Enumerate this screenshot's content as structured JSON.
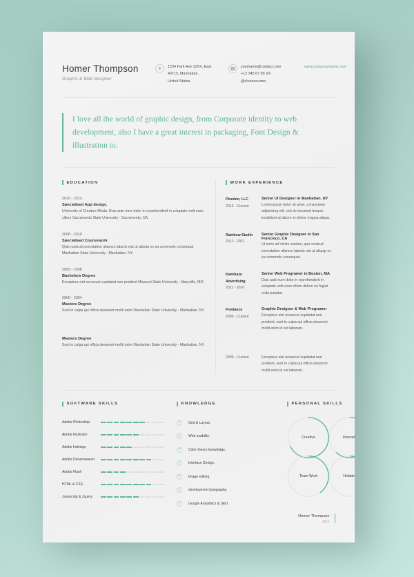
{
  "theme": {
    "accent": "#5fb79b",
    "page_bg": "#f2f2f2",
    "canvas_bg": "#a8ccc2"
  },
  "header": {
    "name": "Homer Thompson",
    "role": "Graphic & Web designer",
    "address_icon": "location-pin-icon",
    "address": [
      "1234 Park Ave 12XX, East",
      "40715, Manhattan.",
      "United States."
    ],
    "phone_icon": "phone-icon",
    "contact": [
      "yourname@contact.com",
      "+12 345 67 89 XX",
      "@cleanresume"
    ],
    "website": "www.companyname.com"
  },
  "quote": "I love all the world of graphic design, from Corporate identity to web development, also I have a great interest in packaging, Font Design & illustration to.",
  "education": {
    "title": "Education",
    "entries": [
      {
        "date": "2010 - 2013",
        "title": "Specialised App design.",
        "desc": "University of Creative Minds: Duis aute irure dolor in reprehenderit in voluptate velit esse cillum Sacramento State University - Sacramento, CA."
      },
      {
        "date": "2008 - 2010",
        "title": "Specialised Coursework",
        "desc": "Quis nostrud exercitation ullamco laboris nisi ut aliquip ex ea commodo consequat Manhattan State University - Manhattan. NY."
      },
      {
        "date": "2005 - 2008",
        "title": "Bachelors Degree",
        "desc": "Excepteur sint occaecat cupidatat non proident Missouri State University - Maryville, MO."
      },
      {
        "date": "2000 - 2004",
        "title": "Masters Degree",
        "desc": "Sunt in culpa qui officia deserunt mollit anim Manhattan State University - Manhattan. NY."
      },
      {
        "date": "",
        "title": "Masters Degree",
        "desc": "Sunt in culpa qui officia deserunt mollit anim Manhattan State University - Manhattan. NY."
      }
    ]
  },
  "work": {
    "title": "Work Experience",
    "entries": [
      {
        "company": "Pixeden, LLC",
        "period": "2013 - Current",
        "title": "Senior UI Designer in Manhattan, NY",
        "desc": "Lorem ipsum dolor sit amet, consectetur adipisicing elit, sed do eiusmod tempor incididunt ut labore et dolore magna aliqua."
      },
      {
        "company": "Rainbow Studio",
        "period": "2012 - 2011",
        "title": "Senior Graphic Designer in San Francisco, CA",
        "desc": "Ut enim ad minim veniam, quis nostrud exercitation ullamco laboris nisi ut aliquip ex ea commodo consequat."
      },
      {
        "company": "Kamikaze Advertising",
        "period": "2011 - 2010",
        "title": "Senior Web Programer in Boston, MA",
        "desc": "Duis aute irure dolor in reprehenderit in voluptate velit esse cillum dolore eu fugiat nulla pariatur."
      },
      {
        "company": "Freelance",
        "period": "2009 - Current",
        "title": "Graphic Designer & Web Programer",
        "desc": "Excepteur sint occaecat cupidatat non proident, sunt in culpa qui officia deserunt mollit anim id est laborum."
      },
      {
        "company": "",
        "period": "2009 - Current",
        "title": "",
        "desc": "Excepteur sint occaecat cupidatat non proident, sunt in culpa qui officia deserunt mollit anim id est laborum."
      }
    ]
  },
  "software_skills": {
    "title": "Software Skills",
    "total_segments": 10,
    "items": [
      {
        "label": "Adobe Photoshop",
        "filled": 7
      },
      {
        "label": "Adobe Illustrator",
        "filled": 6
      },
      {
        "label": "Adobe Indesign",
        "filled": 5
      },
      {
        "label": "Adobe Dreamweaver",
        "filled": 8
      },
      {
        "label": "Adobe Flash",
        "filled": 4
      },
      {
        "label": "HTML & CSS",
        "filled": 8
      },
      {
        "label": "Javascript & Jquery",
        "filled": 6
      }
    ]
  },
  "knowledge": {
    "title": "Knowledge",
    "check_icon": "check-circle-icon",
    "items": [
      "Grid & Layout.",
      "Web usability.",
      "Color theory knowledge.",
      "Interface Design.",
      "Image editing.",
      "development typography.",
      "Google Analythics & SEO."
    ]
  },
  "personal_skills": {
    "title": "Personal Skills",
    "items": [
      {
        "label": "Creative",
        "percent": 68
      },
      {
        "label": "Innovate",
        "percent": 62
      },
      {
        "label": "Team Work",
        "percent": 40
      },
      {
        "label": "Hobbies",
        "percent": 30
      }
    ]
  },
  "footer": {
    "name": "Homer Thompson",
    "year": "2014"
  }
}
